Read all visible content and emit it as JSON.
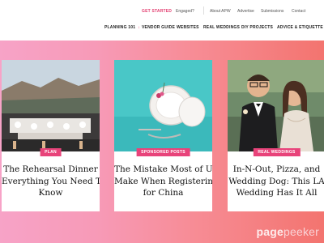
{
  "utility_bar": {
    "get_started": "GET STARTED",
    "engaged": "Engaged?",
    "links": [
      "About APW",
      "Advertise",
      "Submissions",
      "Contact"
    ]
  },
  "nav": {
    "items": [
      "PLANNING 101",
      "VENDOR GUIDE",
      "WEBSITES",
      "REAL WEDDINGS",
      "DIY PROJECTS",
      "ADVICE & ETIQUETTE"
    ]
  },
  "cards": [
    {
      "badge": "PLAN",
      "title_lines": [
        "The Rehearsal Dinner",
        "Everything You Need T",
        "Know"
      ]
    },
    {
      "badge": "SPONSORED POSTS",
      "title_lines": [
        "The Mistake Most of U",
        "Make When Registerin",
        "for China"
      ]
    },
    {
      "badge": "REAL WEDDINGS",
      "title_lines": [
        "In-N-Out, Pizza, and",
        "Wedding Dog: This LA",
        "Wedding Has It All"
      ]
    }
  ],
  "watermark": {
    "text_main": "page",
    "text_light": "peeker"
  },
  "colors": {
    "accent": "#e8437a",
    "hero_start": "#f7a3c7",
    "hero_end": "#f3746f"
  }
}
